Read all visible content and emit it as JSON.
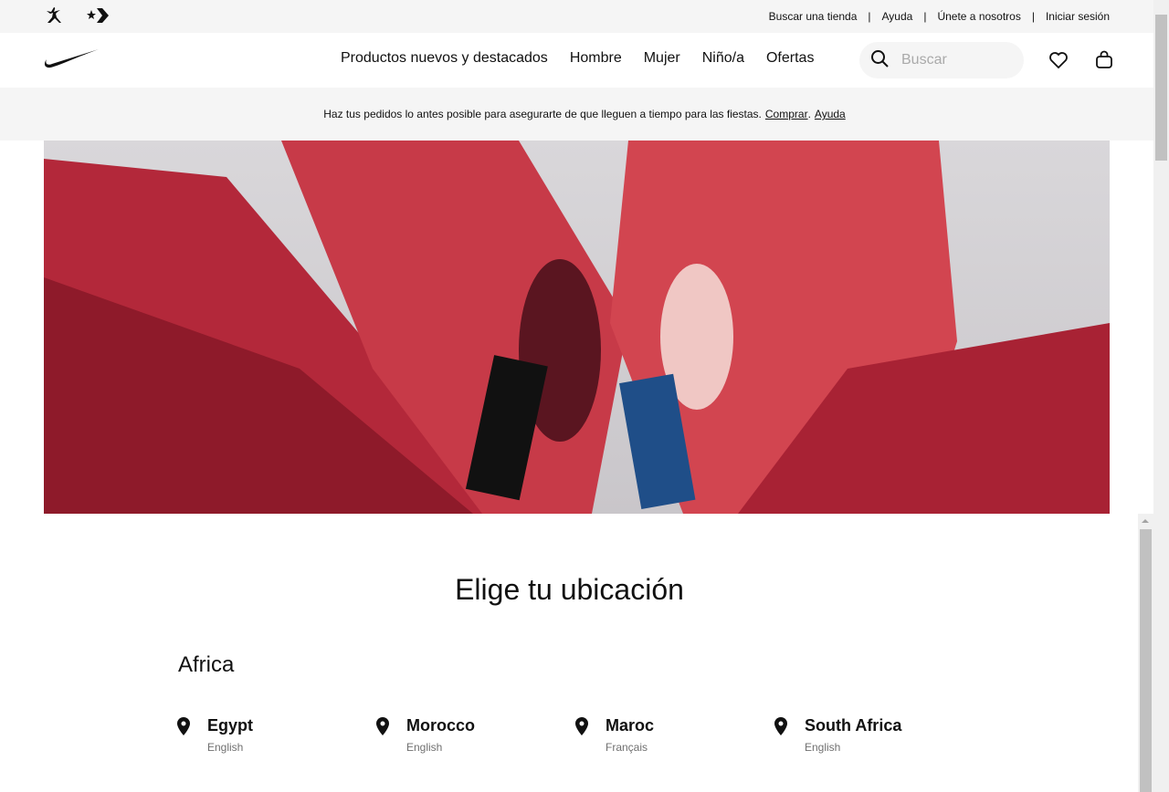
{
  "utility": {
    "links": [
      "Buscar una tienda",
      "Ayuda",
      "Únete a nosotros",
      "Iniciar sesión"
    ]
  },
  "nav": {
    "menu": [
      "Productos nuevos y destacados",
      "Hombre",
      "Mujer",
      "Niño/a",
      "Ofertas"
    ],
    "search_placeholder": "Buscar"
  },
  "promo": {
    "text": "Haz tus pedidos lo antes posible para asegurarte de que lleguen a tiempo para las fiestas.",
    "link1": "Comprar",
    "link2": "Ayuda"
  },
  "page": {
    "title": "Elige tu ubicación",
    "region": "Africa",
    "countries": [
      {
        "name": "Egypt",
        "lang": "English"
      },
      {
        "name": "Morocco",
        "lang": "English"
      },
      {
        "name": "Maroc",
        "lang": "Français"
      },
      {
        "name": "South Africa",
        "lang": "English"
      }
    ]
  }
}
